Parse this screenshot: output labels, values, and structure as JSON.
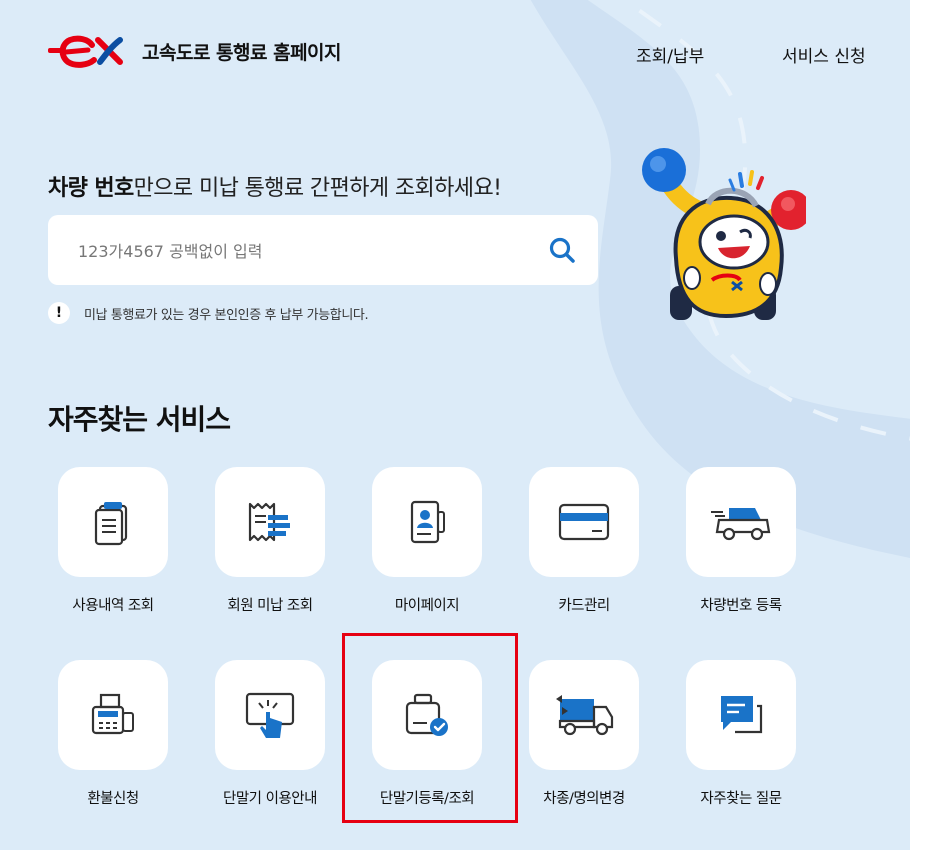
{
  "header": {
    "logo_text": "ex",
    "site_title": "고속도로 통행료 홈페이지",
    "nav": [
      {
        "label": "조회/납부"
      },
      {
        "label": "서비스 신청"
      }
    ]
  },
  "search": {
    "headline_bold": "차량 번호",
    "headline_rest": "만으로 미납 통행료 간편하게 조회하세요!",
    "placeholder": "123가4567 공백없이 입력",
    "notice_icon": "!",
    "notice": "미납 통행료가 있는 경우 본인인증 후 납부 가능합니다."
  },
  "services": {
    "title": "자주찾는 서비스",
    "items": [
      {
        "label": "사용내역 조회",
        "icon": "receipt-list-icon"
      },
      {
        "label": "회원 미납 조회",
        "icon": "bill-check-icon"
      },
      {
        "label": "마이페이지",
        "icon": "profile-book-icon"
      },
      {
        "label": "카드관리",
        "icon": "credit-card-icon"
      },
      {
        "label": "차량번호 등록",
        "icon": "car-icon"
      },
      {
        "label": "환불신청",
        "icon": "fax-printer-icon"
      },
      {
        "label": "단말기 이용안내",
        "icon": "touch-screen-icon"
      },
      {
        "label": "단말기등록/조회",
        "icon": "device-check-icon"
      },
      {
        "label": "차종/명의변경",
        "icon": "truck-swap-icon"
      },
      {
        "label": "자주찾는 질문",
        "icon": "chat-bubble-icon"
      }
    ]
  },
  "colors": {
    "background": "#dcebf8",
    "brand_red": "#e60012",
    "accent_blue": "#1a73c8",
    "highlight_border": "#e60012"
  }
}
